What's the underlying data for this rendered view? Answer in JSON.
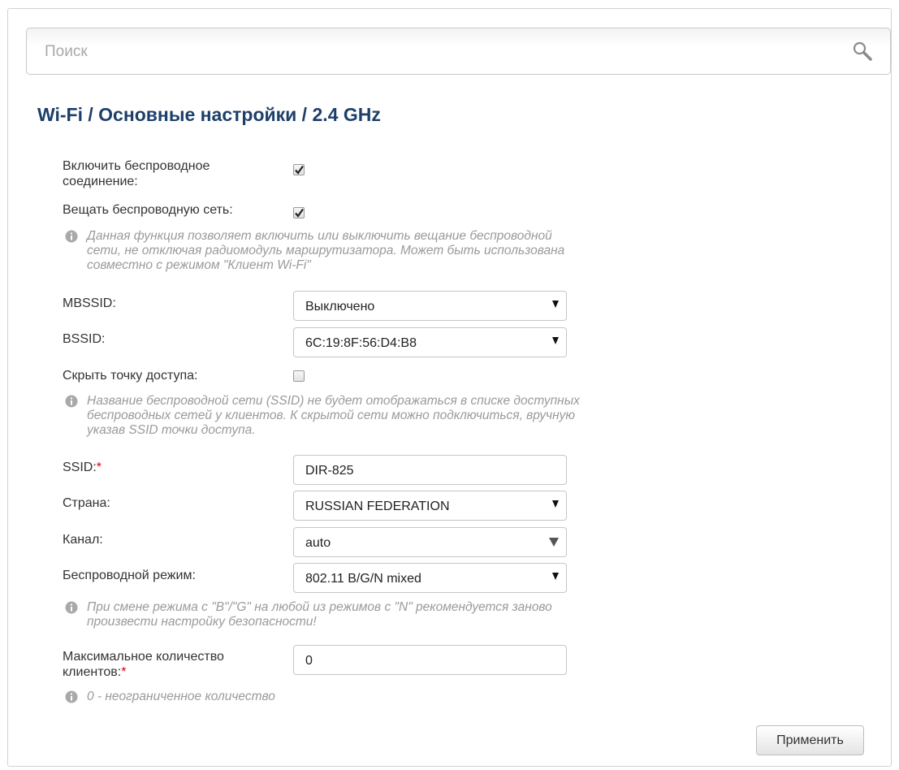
{
  "search": {
    "placeholder": "Поиск",
    "icon": "search-icon"
  },
  "breadcrumb": {
    "part1": "Wi-Fi /",
    "part2": "Основные настройки /",
    "part3": "2.4 GHz"
  },
  "form": {
    "enable_wireless_label_1": "Включить беспроводное",
    "enable_wireless_label_2": "соединение:",
    "enable_wireless_checked": true,
    "broadcast_label": "Вещать беспроводную сеть:",
    "broadcast_checked": true,
    "broadcast_hint_1": "Данная функция позволяет включить или выключить вещание беспроводной",
    "broadcast_hint_2": "сети, не отключая радиомодуль маршрутизатора. Может быть использована",
    "broadcast_hint_3": "совместно с режимом \"Клиент Wi-Fi\"",
    "mbssid_label": "MBSSID:",
    "mbssid_value": "Выключено",
    "bssid_label": "BSSID:",
    "bssid_value": "6C:19:8F:56:D4:B8",
    "hide_ap_label": "Скрыть точку доступа:",
    "hide_ap_checked": false,
    "hide_hint_1": "Название беспроводной сети (SSID) не будет отображаться в списке доступных",
    "hide_hint_2": "беспроводных сетей у клиентов. К скрытой сети можно подключиться, вручную",
    "hide_hint_3": "указав SSID точки доступа.",
    "ssid_label": "SSID:",
    "required_mark": "*",
    "ssid_value": "DIR-825",
    "country_label": "Страна:",
    "country_value": "RUSSIAN FEDERATION",
    "channel_label": "Канал:",
    "channel_value": "auto",
    "mode_label": "Беспроводной режим:",
    "mode_value": "802.11 B/G/N mixed",
    "mode_hint_1": "При смене режима с \"B\"/\"G\" на любой из режимов с \"N\" рекомендуется заново",
    "mode_hint_2": "произвести настройку безопасности!",
    "max_clients_label_1": "Максимальное количество",
    "max_clients_label_2": "клиентов:",
    "max_clients_value": "0",
    "max_clients_hint": "0 - неограниченное количество"
  },
  "apply_button": "Применить",
  "colors": {
    "title": "#1d3f6a",
    "required": "#d0021b",
    "hint": "#9a9a9a"
  }
}
